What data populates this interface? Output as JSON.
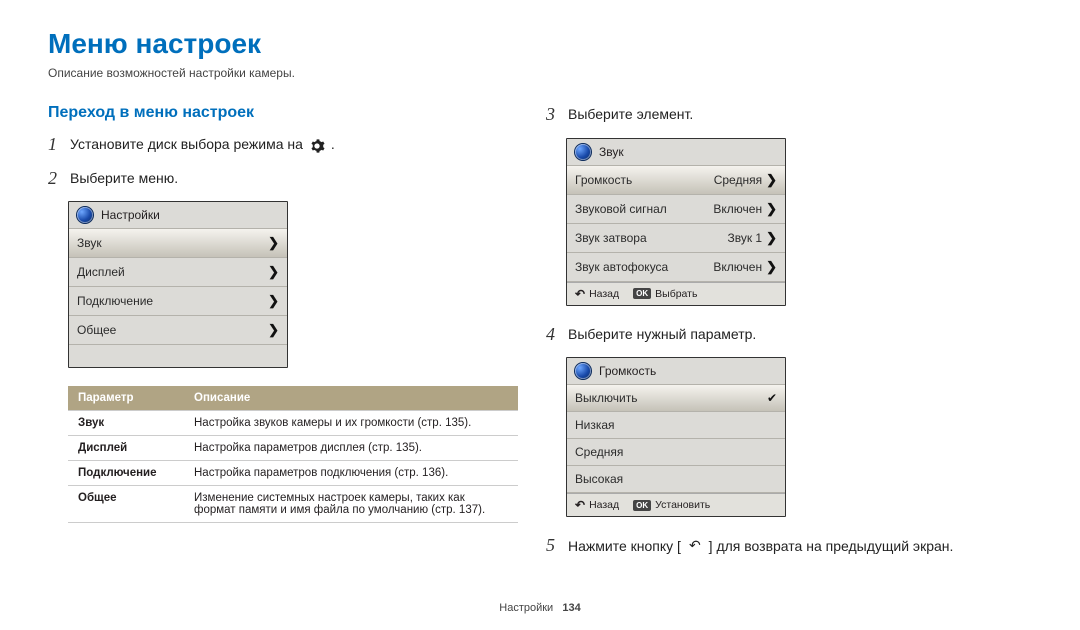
{
  "title": "Меню настроек",
  "subtitle": "Описание возможностей настройки камеры.",
  "section": "Переход в меню настроек",
  "steps": {
    "s1_prefix": "Установите диск выбора режима на ",
    "s1_suffix": ".",
    "s2": "Выберите меню.",
    "s3": "Выберите элемент.",
    "s4": "Выберите нужный параметр.",
    "s5_prefix": "Нажмите кнопку [",
    "s5_glyph": "↶",
    "s5_suffix": "] для возврата на предыдущий экран."
  },
  "panel_menu": {
    "header": "Настройки",
    "rows": [
      "Звук",
      "Дисплей",
      "Подключение",
      "Общее"
    ]
  },
  "panel_sound": {
    "header": "Звук",
    "rows": [
      {
        "label": "Громкость",
        "value": "Средняя"
      },
      {
        "label": "Звуковой сигнал",
        "value": "Включен"
      },
      {
        "label": "Звук затвора",
        "value": "Звук 1"
      },
      {
        "label": "Звук автофокуса",
        "value": "Включен"
      }
    ],
    "footer_back": "Назад",
    "footer_ok": "OK",
    "footer_select": "Выбрать"
  },
  "panel_volume": {
    "header": "Громкость",
    "rows": [
      "Выключить",
      "Низкая",
      "Средняя",
      "Высокая"
    ],
    "footer_back": "Назад",
    "footer_ok": "OK",
    "footer_select": "Установить"
  },
  "param_table": {
    "columns": [
      "Параметр",
      "Описание"
    ],
    "rows": [
      {
        "param": "Звук",
        "desc": "Настройка звуков камеры и их громкости (стр. 135)."
      },
      {
        "param": "Дисплей",
        "desc": "Настройка параметров дисплея (стр. 135)."
      },
      {
        "param": "Подключение",
        "desc": "Настройка параметров подключения (стр. 136)."
      },
      {
        "param": "Общее",
        "desc": "Изменение системных настроек камеры, таких как формат памяти и имя файла по умолчанию (стр. 137)."
      }
    ]
  },
  "footer": {
    "label": "Настройки",
    "page": "134"
  }
}
